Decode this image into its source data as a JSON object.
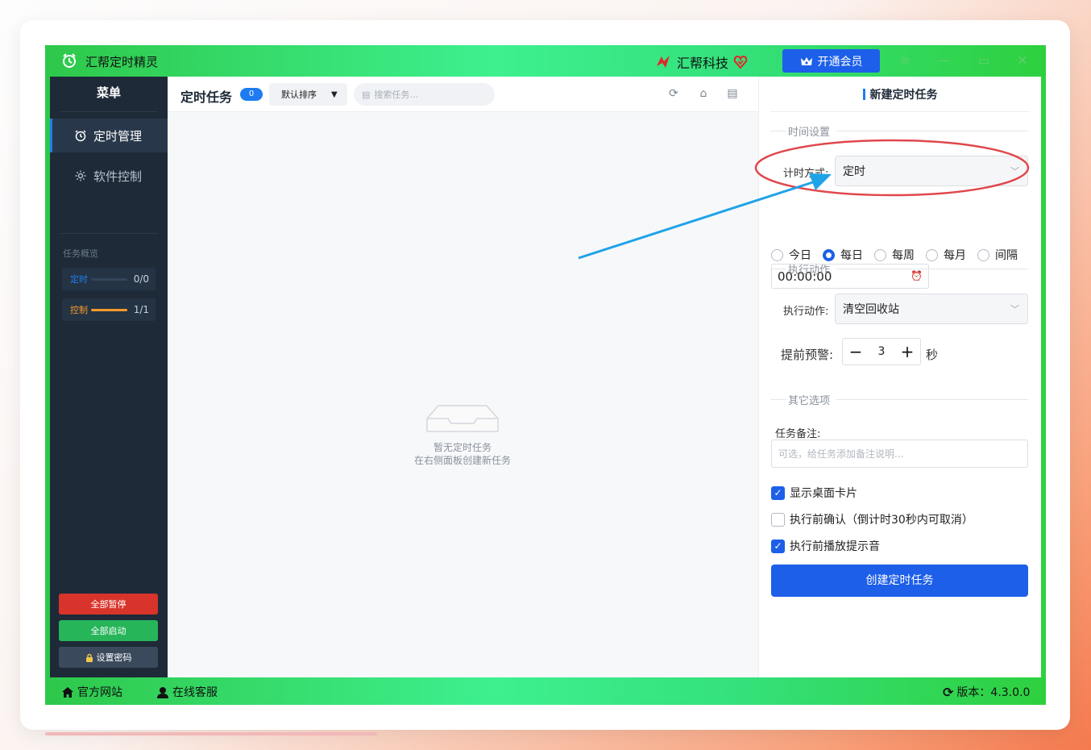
{
  "titlebar": {
    "app_title": "汇帮定时精灵",
    "brand": "汇帮科技",
    "vip_label": "开通会员",
    "accent": "#1d5fe8"
  },
  "sidebar": {
    "header": "菜单",
    "items": [
      {
        "label": "定时管理",
        "icon": "alarm-clock-icon",
        "active": true
      },
      {
        "label": "软件控制",
        "icon": "gear-icon",
        "active": false
      }
    ],
    "overview_label": "任务概览",
    "stats": [
      {
        "label": "定时",
        "count": "0/0",
        "progress": 0,
        "color": "#1d7cf2"
      },
      {
        "label": "控制",
        "count": "1/1",
        "progress": 1,
        "color": "#f39a2b"
      }
    ],
    "buttons": {
      "pause_all": "全部暂停",
      "start_all": "全部启动",
      "set_password": "设置密码"
    }
  },
  "main": {
    "title": "定时任务",
    "task_count": "0",
    "sort_label": "默认排序",
    "search_placeholder": "搜索任务...",
    "empty_line1": "暂无定时任务",
    "empty_line2": "在右侧面板创建新任务"
  },
  "panel": {
    "title": "新建定时任务",
    "section_time": "时间设置",
    "timing_mode_label": "计时方式:",
    "timing_mode_value": "定时",
    "frequency_options": [
      {
        "label": "今日",
        "selected": false
      },
      {
        "label": "每日",
        "selected": true
      },
      {
        "label": "每周",
        "selected": false
      },
      {
        "label": "每月",
        "selected": false
      },
      {
        "label": "间隔",
        "selected": false
      }
    ],
    "time_value": "00:00:00",
    "section_action": "执行动作",
    "action_label": "执行动作:",
    "action_value": "清空回收站",
    "warning_label": "提前预警:",
    "warning_value": "3",
    "warning_unit": "秒",
    "section_other": "其它选项",
    "note_label": "任务备注:",
    "note_placeholder": "可选，给任务添加备注说明...",
    "options": [
      {
        "label": "显示桌面卡片",
        "checked": true
      },
      {
        "label": "执行前确认（倒计时30秒内可取消）",
        "checked": false
      },
      {
        "label": "执行前播放提示音",
        "checked": true
      }
    ],
    "create_button": "创建定时任务"
  },
  "footer": {
    "website": "官方网站",
    "support": "在线客服",
    "version": "版本：4.3.0.0"
  }
}
